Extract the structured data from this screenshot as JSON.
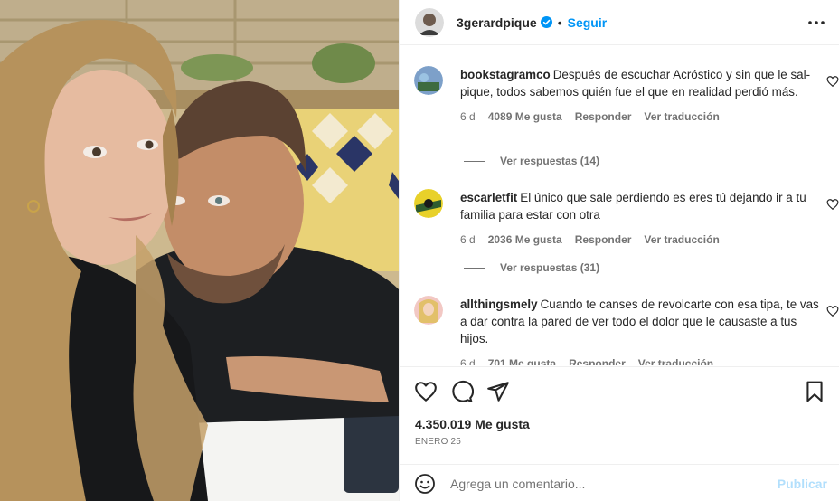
{
  "post": {
    "username": "3gerardpique",
    "follow_label": "Seguir",
    "separator": "•",
    "verified_icon": "verified-badge-icon",
    "more_icon": "more-options-icon"
  },
  "comments": [
    {
      "username": "bookstagramco",
      "text": "Después de escuchar Acróstico y sin que le sal-pique, todos sabemos quién fue el que en realidad perdió más.",
      "age": "6 d",
      "likes": "4089 Me gusta",
      "reply_label": "Responder",
      "translate_label": "Ver traducción",
      "replies_label": "Ver respuestas (14)"
    },
    {
      "username": "escarletfit",
      "text": "El único que sale perdiendo es eres tú dejando ir a tu familia para estar con otra",
      "age": "6 d",
      "likes": "2036 Me gusta",
      "reply_label": "Responder",
      "translate_label": "Ver traducción",
      "replies_label": "Ver respuestas (31)"
    },
    {
      "username": "allthingsmely",
      "text": "Cuando te canses de revolcarte con esa tipa, te vas a dar contra la pared de ver todo el dolor que le causaste a tus hijos.",
      "age": "6 d",
      "likes": "701 Me gusta",
      "reply_label": "Responder",
      "translate_label": "Ver traducción"
    }
  ],
  "footer": {
    "likes": "4.350.019 Me gusta",
    "date": "ENERO 25",
    "comment_placeholder": "Agrega un comentario...",
    "publish_label": "Publicar"
  },
  "colors": {
    "accent": "#0095f6",
    "accent_disabled": "#b2dffc",
    "text": "#262626",
    "secondary_text": "#737373",
    "border": "#efefef"
  }
}
